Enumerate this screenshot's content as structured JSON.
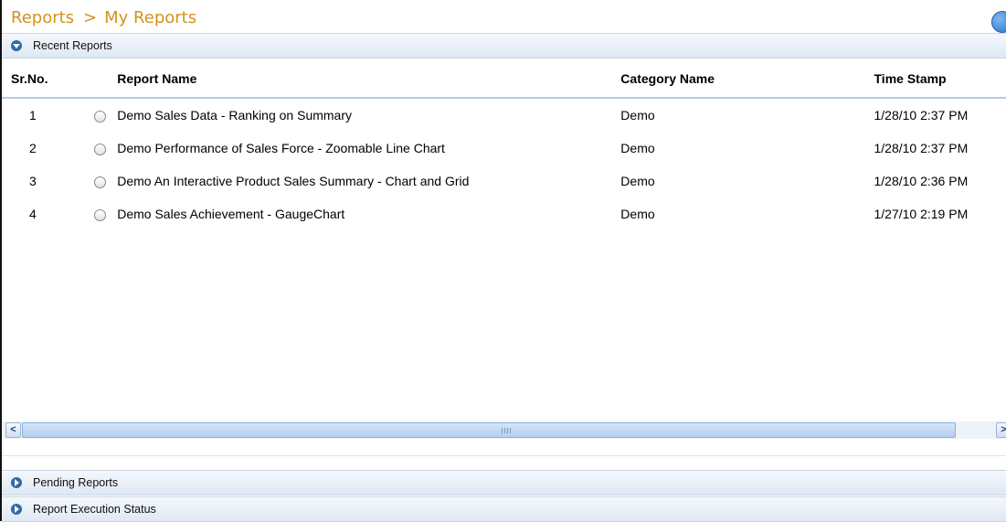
{
  "header": {
    "root": "Reports",
    "separator": ">",
    "page": "My Reports",
    "help_icon": "help-icon"
  },
  "sections": {
    "recent": {
      "label": "Recent Reports",
      "icon": "collapse-down-icon",
      "expanded": true
    },
    "pending": {
      "label": "Pending Reports",
      "icon": "expand-right-icon",
      "expanded": false
    },
    "execution": {
      "label": "Report Execution Status",
      "icon": "expand-right-icon",
      "expanded": false
    }
  },
  "table": {
    "columns": [
      "Sr.No.",
      "Report Name",
      "Category Name",
      "Time Stamp"
    ],
    "rows": [
      {
        "no": "1",
        "name": "Demo Sales Data - Ranking on Summary",
        "category": "Demo",
        "time": "1/28/10 2:37 PM"
      },
      {
        "no": "2",
        "name": "Demo Performance of Sales Force - Zoomable Line Chart",
        "category": "Demo",
        "time": "1/28/10 2:37 PM"
      },
      {
        "no": "3",
        "name": "Demo An Interactive Product Sales Summary - Chart and Grid",
        "category": "Demo",
        "time": "1/28/10 2:36 PM"
      },
      {
        "no": "4",
        "name": "Demo Sales Achievement - GaugeChart",
        "category": "Demo",
        "time": "1/27/10 2:19 PM"
      }
    ]
  },
  "scrollbar": {
    "left_arrow": "<",
    "right_arrow": ">"
  },
  "colors": {
    "title": "#d4921b",
    "accent": "#2f6aa6",
    "section_bg": "#dfe8f3"
  }
}
